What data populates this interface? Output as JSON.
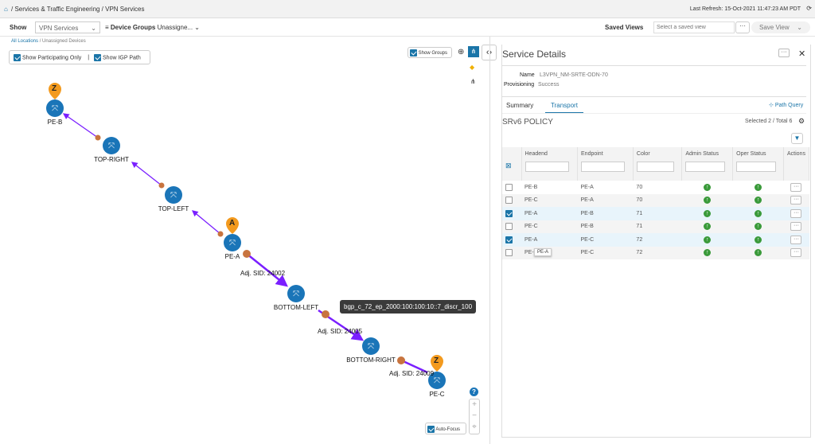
{
  "breadcrumb": {
    "path": "/ Services & Traffic Engineering / VPN Services",
    "last_refresh": "Last Refresh: 15-Oct-2021 11:47:23 AM PDT"
  },
  "toolbar": {
    "show_label": "Show",
    "show_value": "VPN Services",
    "device_groups_label": "Device Groups",
    "device_groups_value": "Unassigne...",
    "saved_views_label": "Saved Views",
    "saved_view_placeholder": "Select a saved view",
    "save_view": "Save View"
  },
  "map": {
    "location": "All Locations",
    "location_sub": "/ Unassigned Devices",
    "show_participating": "Show Participating Only",
    "show_igp": "Show IGP Path",
    "show_groups": "Show Groups",
    "auto_focus": "Auto-Focus",
    "nodes": [
      "PE-B",
      "TOP-RIGHT",
      "TOP-LEFT",
      "PE-A",
      "BOTTOM-LEFT",
      "BOTTOM-RIGHT",
      "PE-C"
    ],
    "markers": [
      "Z",
      "A",
      "Z"
    ],
    "sids": [
      "Adj. SID: 24002",
      "Adj. SID: 24005",
      "Adj. SID: 24009"
    ],
    "tooltip": "bgp_c_72_ep_2000:100:100:10::7_discr_100",
    "link_color": "#7a1fff",
    "node_color": "#1a75b8",
    "marker_color": "#f39a1e"
  },
  "details": {
    "title": "Service Details",
    "name_label": "Name",
    "name_value": "L3VPN_NM-SRTE-ODN-70",
    "prov_label": "Provisioning",
    "prov_value": "Success",
    "tabs": [
      "Summary",
      "Transport"
    ],
    "path_query": "Path Query",
    "policy_title": "SRv6 POLICY",
    "selection": "Selected 2 / Total 6",
    "columns": [
      "Headend",
      "Endpoint",
      "Color",
      "Admin Status",
      "Oper Status",
      "Actions"
    ],
    "rows": [
      {
        "headend": "PE-B",
        "endpoint": "PE-A",
        "color": "70",
        "checked": false
      },
      {
        "headend": "PE-C",
        "endpoint": "PE-A",
        "color": "70",
        "checked": false
      },
      {
        "headend": "PE-A",
        "endpoint": "PE-B",
        "color": "71",
        "checked": true
      },
      {
        "headend": "PE-C",
        "endpoint": "PE-B",
        "color": "71",
        "checked": false
      },
      {
        "headend": "PE-A",
        "endpoint": "PE-C",
        "color": "72",
        "checked": true
      },
      {
        "headend": "PE-",
        "endpoint": "PE-C",
        "color": "72",
        "checked": false
      }
    ],
    "row_tooltip": "PE-A"
  }
}
